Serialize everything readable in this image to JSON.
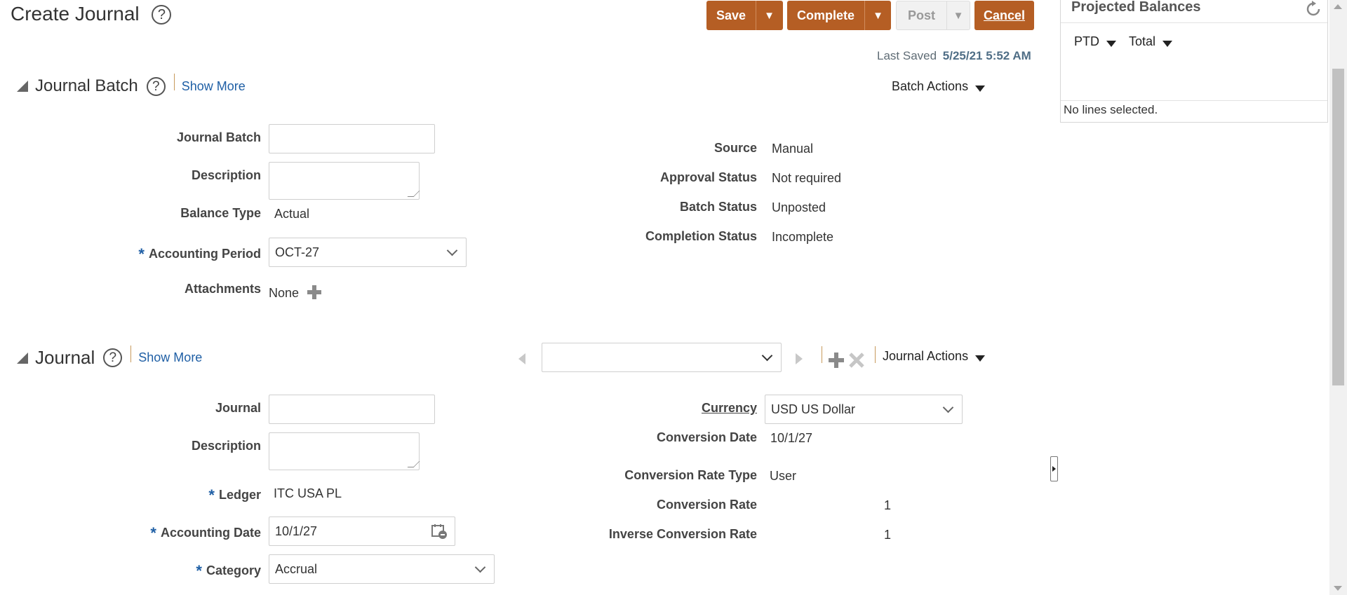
{
  "page": {
    "title": "Create Journal",
    "help_glyph": "?"
  },
  "toolbar": {
    "save_label": "Save",
    "complete_label": "Complete",
    "post_label": "Post",
    "cancel_label": "Cancel",
    "dropdown_glyph": "▼"
  },
  "last_saved": {
    "label": "Last Saved",
    "value": "5/25/21 5:52 AM"
  },
  "journal_batch_section": {
    "title": "Journal Batch",
    "show_more": "Show More",
    "actions_label": "Batch Actions",
    "fields": {
      "journal_batch_label": "Journal Batch",
      "journal_batch_value": "",
      "description_label": "Description",
      "description_value": "",
      "balance_type_label": "Balance Type",
      "balance_type_value": "Actual",
      "accounting_period_label": "Accounting Period",
      "accounting_period_value": "OCT-27",
      "attachments_label": "Attachments",
      "attachments_value": "None",
      "source_label": "Source",
      "source_value": "Manual",
      "approval_status_label": "Approval Status",
      "approval_status_value": "Not required",
      "batch_status_label": "Batch Status",
      "batch_status_value": "Unposted",
      "completion_status_label": "Completion Status",
      "completion_status_value": "Incomplete"
    }
  },
  "journal_section": {
    "title": "Journal",
    "show_more": "Show More",
    "actions_label": "Journal Actions",
    "journal_selector_value": "",
    "fields": {
      "journal_label": "Journal",
      "journal_value": "",
      "description_label": "Description",
      "description_value": "",
      "ledger_label": "Ledger",
      "ledger_value": "ITC USA PL",
      "accounting_date_label": "Accounting Date",
      "accounting_date_value": "10/1/27",
      "category_label": "Category",
      "category_value": "Accrual",
      "currency_label": "Currency",
      "currency_value": "USD US Dollar",
      "conversion_date_label": "Conversion Date",
      "conversion_date_value": "10/1/27",
      "conversion_rate_type_label": "Conversion Rate Type",
      "conversion_rate_type_value": "User",
      "conversion_rate_label": "Conversion Rate",
      "conversion_rate_value": "1",
      "inverse_conversion_rate_label": "Inverse Conversion Rate",
      "inverse_conversion_rate_value": "1"
    }
  },
  "projected_balances": {
    "title": "Projected Balances",
    "ptd_label": "PTD",
    "total_label": "Total",
    "empty_message": "No lines selected."
  },
  "colors": {
    "accent_orange": "#b55e24",
    "link_blue": "#1f5fa5",
    "required_marker": "#1f5fa5"
  },
  "icons": {
    "help": "help-icon",
    "collapse": "collapse-triangle-icon",
    "add": "plus-icon",
    "remove": "x-icon",
    "calendar": "calendar-icon",
    "refresh": "refresh-icon"
  }
}
